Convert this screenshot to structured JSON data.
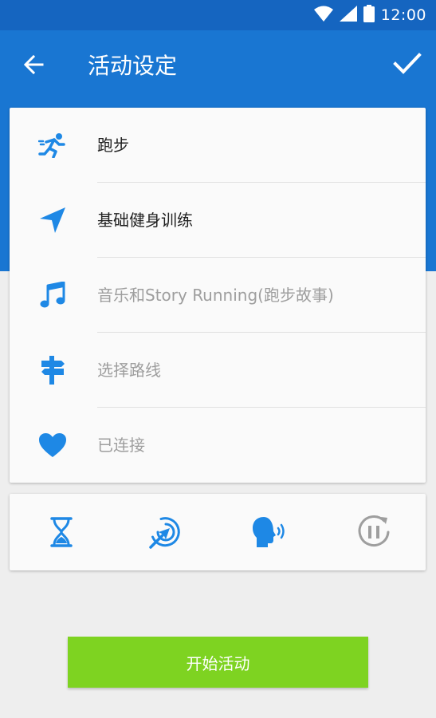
{
  "status_bar": {
    "time": "12:00"
  },
  "app_bar": {
    "title": "活动设定"
  },
  "settings": {
    "items": [
      {
        "label": "跑步",
        "icon": "running-icon"
      },
      {
        "label": "基础健身训练",
        "icon": "navigation-arrow-icon"
      },
      {
        "label": "音乐和Story Running(跑步故事)",
        "icon": "music-note-icon"
      },
      {
        "label": "选择路线",
        "icon": "signpost-icon"
      },
      {
        "label": "已连接",
        "icon": "heart-icon"
      }
    ]
  },
  "quick_tools": [
    "hourglass-icon",
    "target-arrow-icon",
    "voice-coach-icon",
    "auto-pause-icon"
  ],
  "start_button": {
    "label": "开始活动"
  },
  "colors": {
    "status_bar": "#1565c0",
    "app_bar": "#1976d2",
    "accent": "#1e88e5",
    "start": "#7ed321",
    "muted": "#9e9e9e"
  }
}
